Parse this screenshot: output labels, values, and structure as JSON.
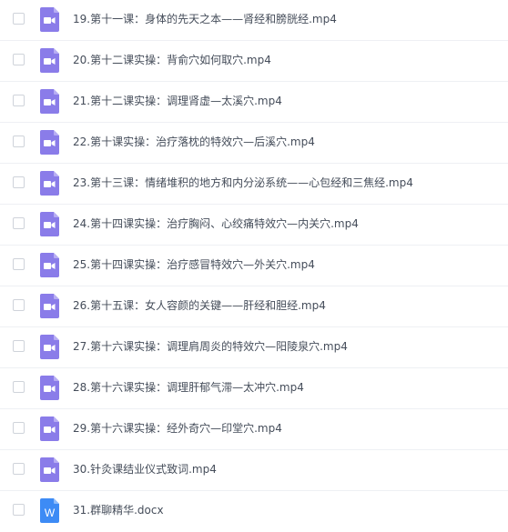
{
  "files": [
    {
      "name": "19.第十一课：身体的先天之本——肾经和膀胱经.mp4",
      "type": "video",
      "icon": "video-file-icon"
    },
    {
      "name": "20.第十二课实操：背俞穴如何取穴.mp4",
      "type": "video",
      "icon": "video-file-icon"
    },
    {
      "name": "21.第十二课实操：调理肾虚—太溪穴.mp4",
      "type": "video",
      "icon": "video-file-icon"
    },
    {
      "name": "22.第十课实操：治疗落枕的特效穴—后溪穴.mp4",
      "type": "video",
      "icon": "video-file-icon"
    },
    {
      "name": "23.第十三课：情绪堆积的地方和内分泌系统——心包经和三焦经.mp4",
      "type": "video",
      "icon": "video-file-icon"
    },
    {
      "name": "24.第十四课实操：治疗胸闷、心绞痛特效穴—内关穴.mp4",
      "type": "video",
      "icon": "video-file-icon"
    },
    {
      "name": "25.第十四课实操：治疗感冒特效穴—外关穴.mp4",
      "type": "video",
      "icon": "video-file-icon"
    },
    {
      "name": "26.第十五课：女人容颜的关键——肝经和胆经.mp4",
      "type": "video",
      "icon": "video-file-icon"
    },
    {
      "name": "27.第十六课实操：调理肩周炎的特效穴—阳陵泉穴.mp4",
      "type": "video",
      "icon": "video-file-icon"
    },
    {
      "name": "28.第十六课实操：调理肝郁气滞—太冲穴.mp4",
      "type": "video",
      "icon": "video-file-icon"
    },
    {
      "name": "29.第十六课实操：经外奇穴—印堂穴.mp4",
      "type": "video",
      "icon": "video-file-icon"
    },
    {
      "name": "30.针灸课结业仪式致词.mp4",
      "type": "video",
      "icon": "video-file-icon"
    },
    {
      "name": "31.群聊精华.docx",
      "type": "word",
      "icon": "word-file-icon",
      "icon_letter": "W"
    }
  ],
  "colors": {
    "video_icon": "#8a7ce9",
    "video_icon_fold": "#b7adf3",
    "word_icon": "#3d8bf5",
    "word_icon_fold": "#8dbbfa"
  }
}
